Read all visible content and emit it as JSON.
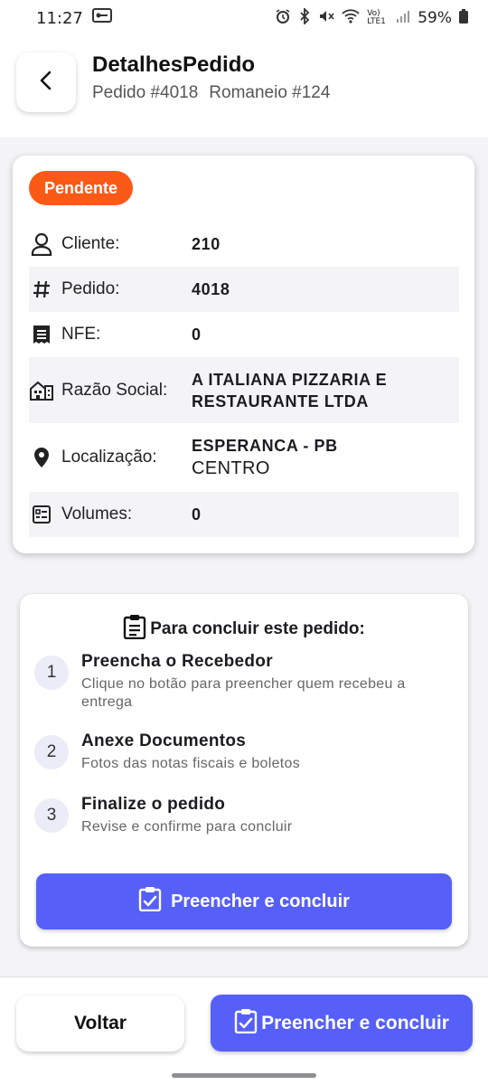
{
  "status_bar": {
    "time": "11:27",
    "battery": "59%",
    "network": "Vo) LTE1"
  },
  "header": {
    "title": "DetalhesPedido",
    "order_ref": "Pedido #4018",
    "romaneio_ref": "Romaneio #124"
  },
  "info": {
    "status_badge": "Pendente",
    "status_color": "#fb5a16",
    "rows": [
      {
        "icon": "user-icon",
        "label": "Cliente:",
        "value": "210"
      },
      {
        "icon": "hash-icon",
        "label": "Pedido:",
        "value": "4018"
      },
      {
        "icon": "receipt-icon",
        "label": "NFE:",
        "value": "0"
      },
      {
        "icon": "building-icon",
        "label": "Razão Social:",
        "value": "A ITALIANA PIZZARIA E RESTAURANTE LTDA"
      },
      {
        "icon": "location-pin-icon",
        "label": "Localização:",
        "value": "ESPERANCA - PB",
        "value2": "CENTRO"
      },
      {
        "icon": "list-box-icon",
        "label": "Volumes:",
        "value": "0"
      }
    ]
  },
  "steps": {
    "title": "Para concluir este pedido:",
    "items": [
      {
        "num": "1",
        "title": "Preencha o Recebedor",
        "desc": "Clique no botão para preencher quem recebeu a entrega"
      },
      {
        "num": "2",
        "title": "Anexe Documentos",
        "desc": "Fotos das notas fiscais e boletos"
      },
      {
        "num": "3",
        "title": "Finalize o pedido",
        "desc": "Revise e confirme para concluir"
      }
    ],
    "button_label": "Preencher e concluir"
  },
  "footer": {
    "back_label": "Voltar",
    "primary_label": "Preencher e concluir"
  },
  "colors": {
    "accent": "#5660f8",
    "pending": "#fb5a16"
  }
}
